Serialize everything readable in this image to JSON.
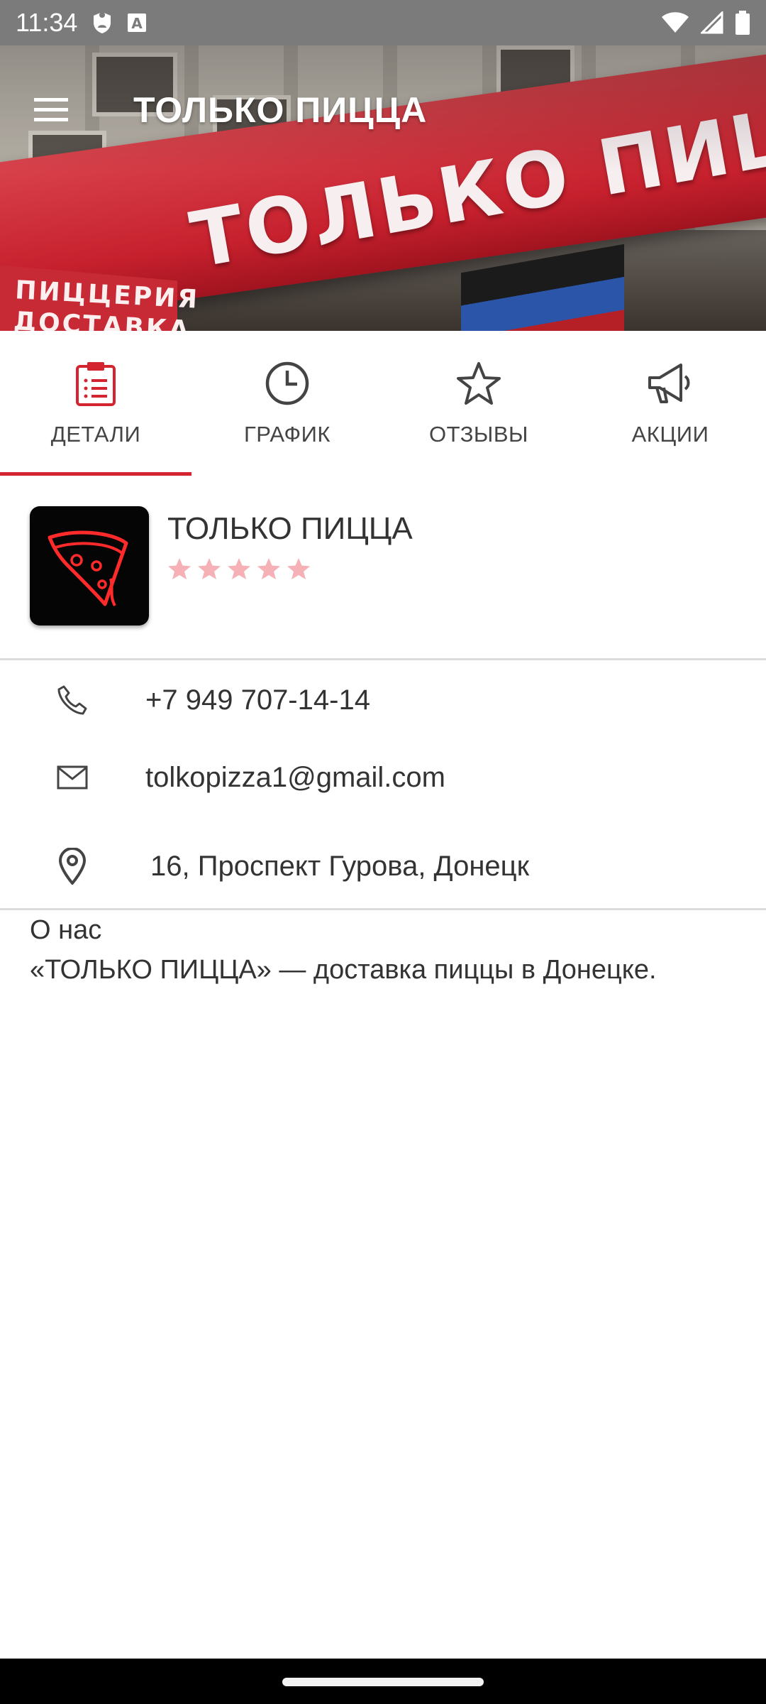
{
  "status_bar": {
    "time": "11:34",
    "icons": [
      "shield-icon",
      "text-a-icon",
      "wifi-icon",
      "signal-icon",
      "battery-icon"
    ]
  },
  "header": {
    "title": "ТОЛЬКО ПИЦЦА",
    "menu_icon": "menu-icon"
  },
  "hero_image": {
    "sign_text": "ТОЛЬКО ПИЦЦА",
    "sign_small_line1": "ПИЦЦЕРИЯ",
    "sign_small_line2": "ДОСТАВКА"
  },
  "tabs": [
    {
      "label": "ДЕТАЛИ",
      "icon": "clipboard-icon",
      "active": true
    },
    {
      "label": "ГРАФИК",
      "icon": "clock-icon",
      "active": false
    },
    {
      "label": "ОТЗЫВЫ",
      "icon": "star-icon",
      "active": false
    },
    {
      "label": "АКЦИИ",
      "icon": "megaphone-icon",
      "active": false
    }
  ],
  "business": {
    "name": "ТОЛЬКО ПИЦЦА",
    "rating_stars": 5,
    "star_color": "#f5b1b6"
  },
  "contacts": {
    "phone": "+7 949 707-14-14",
    "email": "tolkopizza1@gmail.com",
    "address": "16, Проспект Гурова, Донецк"
  },
  "about": {
    "title": "О нас",
    "text": "«ТОЛЬКО ПИЦЦА» — доставка пиццы в Донецке."
  },
  "colors": {
    "accent": "#d3242f",
    "status_bar": "#7b7b7b"
  }
}
